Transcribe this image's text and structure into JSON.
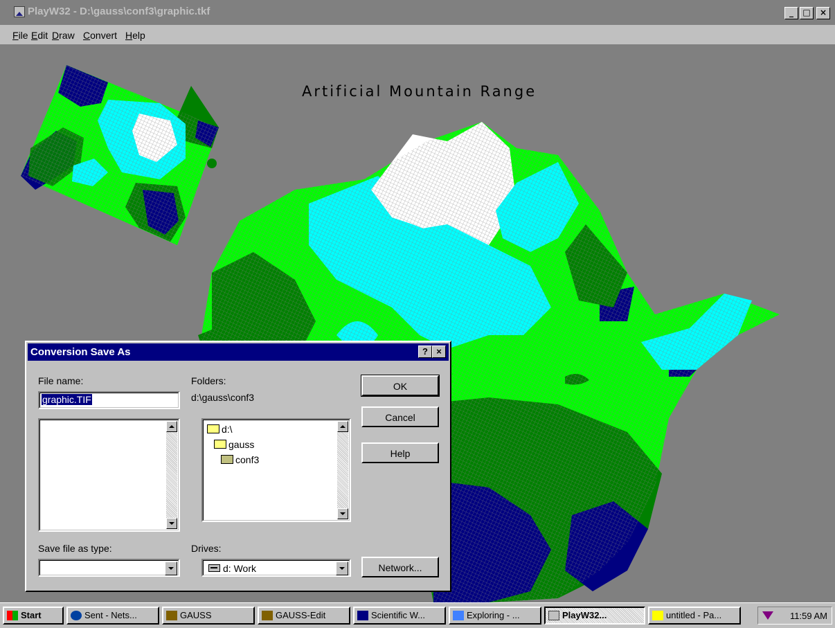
{
  "window": {
    "title": "PlayW32 - D:\\gauss\\conf3\\graphic.tkf",
    "controls": {
      "minimize": "_",
      "maximize": "□",
      "close": "×"
    }
  },
  "menu": [
    "File",
    "Edit",
    "Draw",
    "Convert",
    "Help"
  ],
  "plot": {
    "title": "Artificial Mountain Range",
    "colors": {
      "peak": "#ffffff",
      "high": "#00ffff",
      "mid": "#00ff00",
      "low": "#008000",
      "valley": "#000080"
    }
  },
  "dialog": {
    "title": "Conversion Save As",
    "help_btn": "?",
    "close_btn": "×",
    "file_name_label": "File name:",
    "file_name_value": "graphic.TIF",
    "folders_label": "Folders:",
    "current_path": "d:\\gauss\\conf3",
    "folders": [
      "d:\\",
      "gauss",
      "conf3"
    ],
    "save_type_label": "Save file as type:",
    "save_type_value": "",
    "drives_label": "Drives:",
    "drive_value": "d: Work",
    "buttons": {
      "ok": "OK",
      "cancel": "Cancel",
      "help": "Help",
      "network": "Network..."
    }
  },
  "taskbar": {
    "start": "Start",
    "tasks": [
      "Sent - Nets...",
      "GAUSS",
      "GAUSS-Edit",
      "Scientific W...",
      "Exploring - ...",
      "PlayW32...",
      "untitled - Pa..."
    ],
    "active_task": "PlayW32...",
    "clock": "11:59 AM"
  }
}
